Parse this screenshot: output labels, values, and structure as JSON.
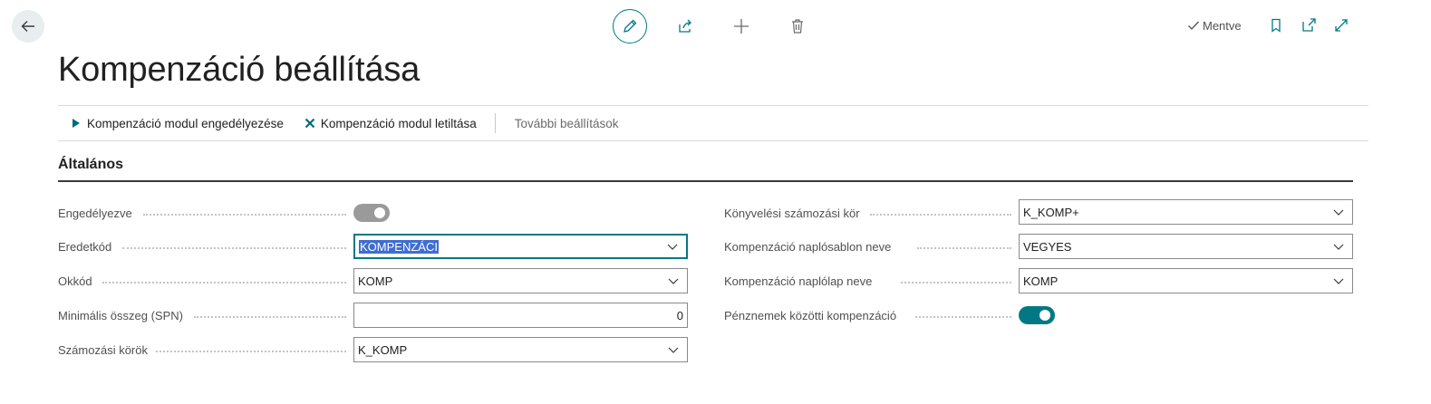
{
  "header": {
    "back_icon": "arrow-left-icon",
    "edit_icon": "pencil-icon",
    "share_icon": "share-icon",
    "new_icon": "plus-icon",
    "delete_icon": "trash-icon",
    "saved_label": "Mentve",
    "bookmark_icon": "bookmark-icon",
    "open_new_window_icon": "open-in-new-window-icon",
    "expand_icon": "expand-icon"
  },
  "page": {
    "title": "Kompenzáció beállítása"
  },
  "actions": {
    "enable_label": "Kompenzáció modul engedélyezése",
    "disable_label": "Kompenzáció modul letiltása",
    "more_label": "További beállítások"
  },
  "section": {
    "title": "Általános"
  },
  "fields_left": [
    {
      "label": "Engedélyezve",
      "type": "toggle",
      "value": "off"
    },
    {
      "label": "Eredetkód",
      "type": "select",
      "value": "KOMPENZÁCI"
    },
    {
      "label": "Okkód",
      "type": "select",
      "value": "KOMP"
    },
    {
      "label": "Minimális összeg (SPN)",
      "type": "number",
      "value": "0"
    },
    {
      "label": "Számozási körök",
      "type": "select",
      "value": "K_KOMP"
    }
  ],
  "fields_right": [
    {
      "label": "Könyvelési számozási kör",
      "type": "select",
      "value": "K_KOMP+"
    },
    {
      "label": "Kompenzáció naplósablon neve",
      "type": "select",
      "value": "VEGYES"
    },
    {
      "label": "Kompenzáció naplólap neve",
      "type": "select",
      "value": "KOMP"
    },
    {
      "label": "Pénznemek közötti kompenzáció",
      "type": "toggle",
      "value": "on"
    }
  ],
  "colors": {
    "accent": "#007985",
    "selection": "#3f6dd1"
  }
}
